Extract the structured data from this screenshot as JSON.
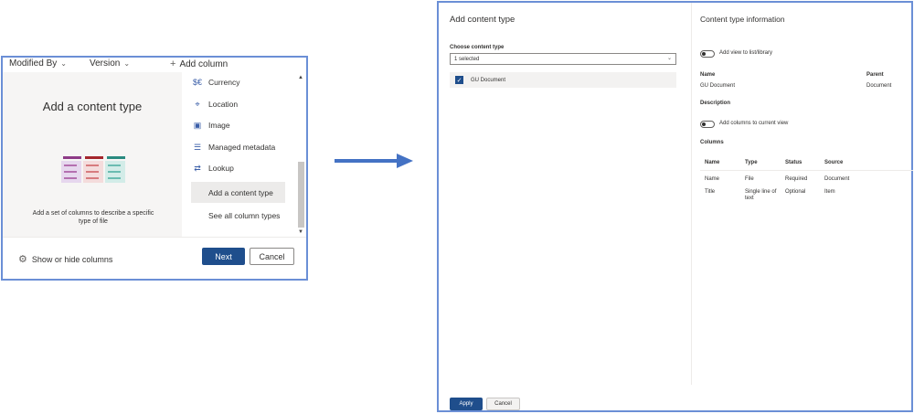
{
  "left_panel": {
    "columns": {
      "modified_by": "Modified By",
      "version": "Version",
      "add_column": "Add column"
    },
    "content_type_card": {
      "title": "Add a content type",
      "description": "Add a set of columns to describe a specific type of file"
    },
    "menu_items": [
      {
        "label": "Currency",
        "icon": "currency-icon",
        "glyph": "$€"
      },
      {
        "label": "Location",
        "icon": "location-pin-icon",
        "glyph": "⌖"
      },
      {
        "label": "Image",
        "icon": "image-icon",
        "glyph": "▣"
      },
      {
        "label": "Managed metadata",
        "icon": "managed-metadata-icon",
        "glyph": "☰"
      },
      {
        "label": "Lookup",
        "icon": "lookup-icon",
        "glyph": "⇄"
      },
      {
        "label": "Add a content type",
        "selected": true
      },
      {
        "label": "See all column types"
      }
    ],
    "footer": {
      "show_hide": "Show or hide columns",
      "next": "Next",
      "cancel": "Cancel"
    }
  },
  "right_panel": {
    "title": "Add content type",
    "choose_label": "Choose content type",
    "dropdown_value": "1 selected",
    "selected_item": "GU Document",
    "info": {
      "title": "Content type information",
      "add_view_label": "Add view to list/library",
      "name_label": "Name",
      "name_value": "GU Document",
      "parent_label": "Parent",
      "parent_value": "Document",
      "description_label": "Description",
      "add_columns_label": "Add columns to current view",
      "columns_label": "Columns",
      "table_headers": [
        "Name",
        "Type",
        "Status",
        "Source"
      ],
      "rows": [
        [
          "Name",
          "File",
          "Required",
          "Document"
        ],
        [
          "Title",
          "Single line of text",
          "Optional",
          "Item"
        ]
      ]
    },
    "footer": {
      "apply": "Apply",
      "cancel": "Cancel"
    }
  },
  "colors": {
    "accent": "#1f4e8c",
    "border": "#6b8fd6",
    "arrow": "#4472c4"
  }
}
